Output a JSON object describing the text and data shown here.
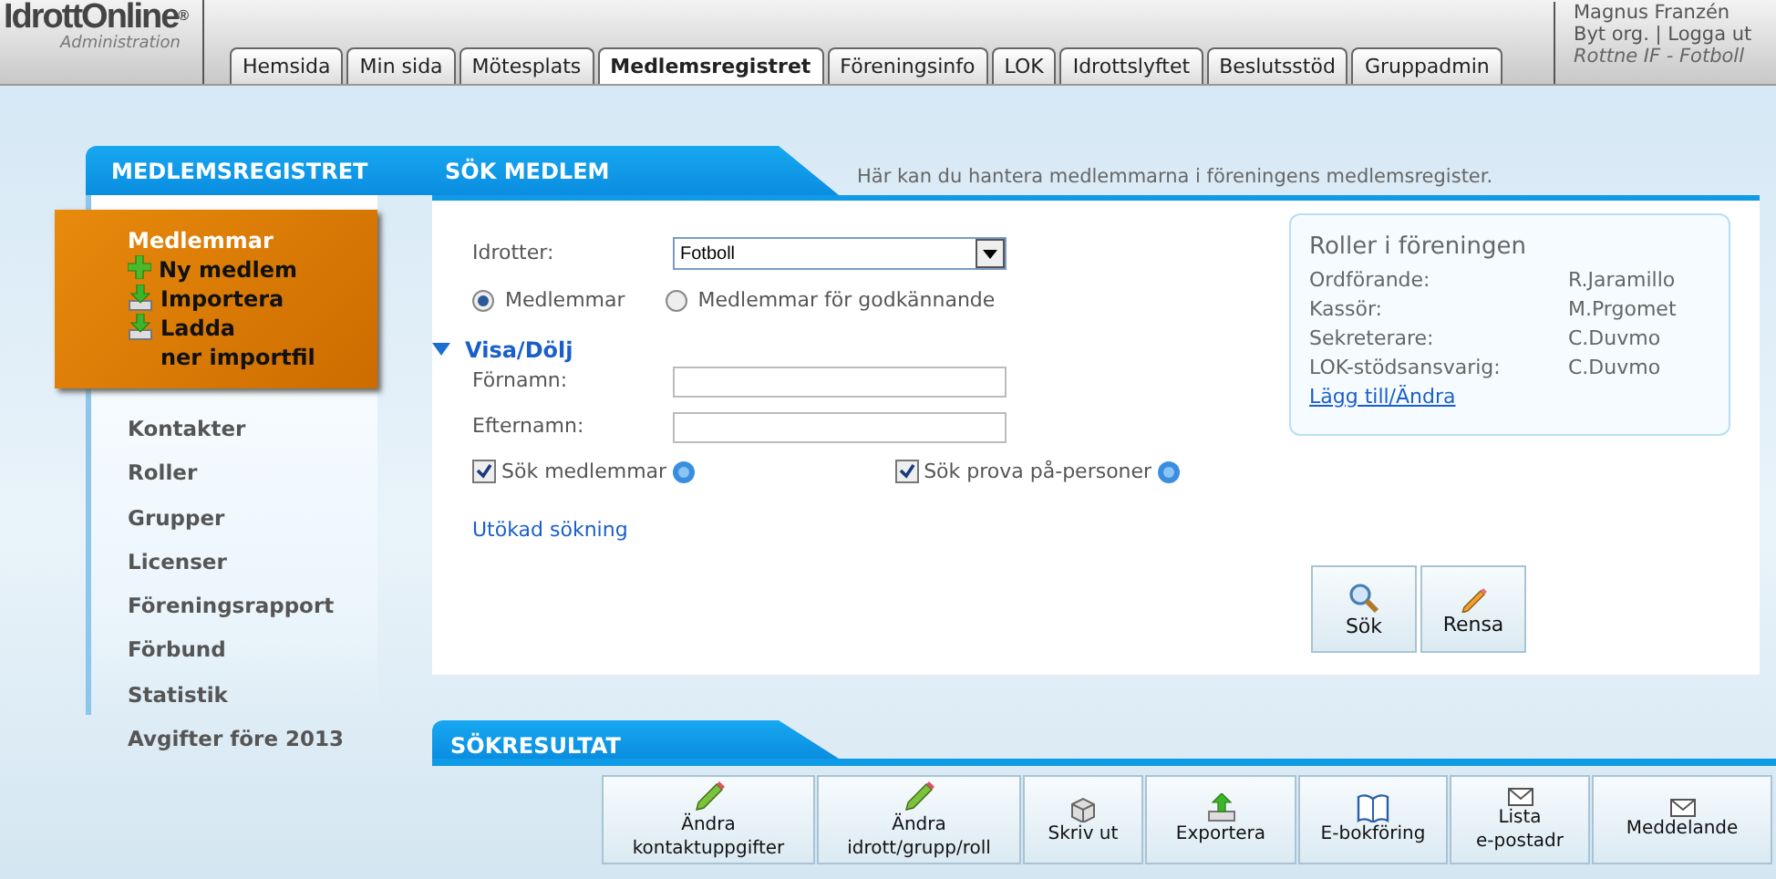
{
  "header": {
    "logo": "IdrottOnline",
    "logo_mark": "®",
    "logo_sub": "Administration",
    "tabs": [
      {
        "label": "Hemsida",
        "selected": false
      },
      {
        "label": "Min sida",
        "selected": false
      },
      {
        "label": "Mötesplats",
        "selected": false
      },
      {
        "label": "Medlemsregistret",
        "selected": true
      },
      {
        "label": "Föreningsinfo",
        "selected": false
      },
      {
        "label": "LOK",
        "selected": false
      },
      {
        "label": "Idrottslyftet",
        "selected": false
      },
      {
        "label": "Beslutsstöd",
        "selected": false
      },
      {
        "label": "Gruppadmin",
        "selected": false
      }
    ],
    "user": {
      "name": "Magnus Franzén",
      "links": [
        "Byt org.",
        "Logga ut"
      ],
      "separator": "|",
      "org": "Rottne IF - Fotboll"
    }
  },
  "sidebar": {
    "title": "MEDLEMSREGISTRET",
    "active": {
      "title": "Medlemmar",
      "actions": [
        {
          "label": "Ny medlem",
          "kind": "add"
        },
        {
          "label": "Importera",
          "kind": "download"
        },
        {
          "label": "Ladda\nner importfil",
          "kind": "download"
        }
      ]
    },
    "items": [
      "Kontakter",
      "Roller",
      "Grupper",
      "Licenser",
      "Föreningsrapport",
      "Förbund",
      "Statistik",
      "Avgifter före 2013"
    ]
  },
  "search": {
    "title": "SÖK MEDLEM",
    "description": "Här kan du hantera medlemmarna i föreningens medlemsregister.",
    "sport_label": "Idrotter:",
    "sport_value": "Fotboll",
    "radios": [
      {
        "label": "Medlemmar",
        "selected": true
      },
      {
        "label": "Medlemmar för godkännande",
        "selected": false
      }
    ],
    "toggle": "Visa/Dölj",
    "expanded": true,
    "fields": [
      {
        "label": "Förnamn:"
      },
      {
        "label": "Efternamn:"
      }
    ],
    "checkboxes": [
      {
        "label": "Sök medlemmar",
        "checked": true
      },
      {
        "label": "Sök prova på-personer",
        "checked": true
      }
    ],
    "extended_link": "Utökad sökning",
    "buttons": [
      {
        "label": "Sök",
        "kind": "search"
      },
      {
        "label": "Rensa",
        "kind": "clear"
      }
    ]
  },
  "roles": {
    "title": "Roller i föreningen",
    "rows": [
      {
        "role": "Ordförande:",
        "name": "R.Jaramillo"
      },
      {
        "role": "Kassör:",
        "name": "M.Prgomet"
      },
      {
        "role": "Sekreterare:",
        "name": "C.Duvmo"
      },
      {
        "role": "LOK-stödsansvarig:",
        "name": "C.Duvmo"
      }
    ],
    "link": "Lägg till/Ändra"
  },
  "results": {
    "title": "SÖKRESULTAT",
    "buttons": [
      {
        "label": "Ändra\nkontaktuppgifter",
        "kind": "edit"
      },
      {
        "label": "Ändra\nidrott/grupp/roll",
        "kind": "edit"
      },
      {
        "label": "Skriv ut",
        "kind": "print"
      },
      {
        "label": "Exportera",
        "kind": "export"
      },
      {
        "label": "E-bokföring",
        "kind": "book"
      },
      {
        "label": "Lista\ne-postadr",
        "kind": "mail"
      },
      {
        "label": "Meddelande",
        "kind": "mail"
      }
    ]
  }
}
